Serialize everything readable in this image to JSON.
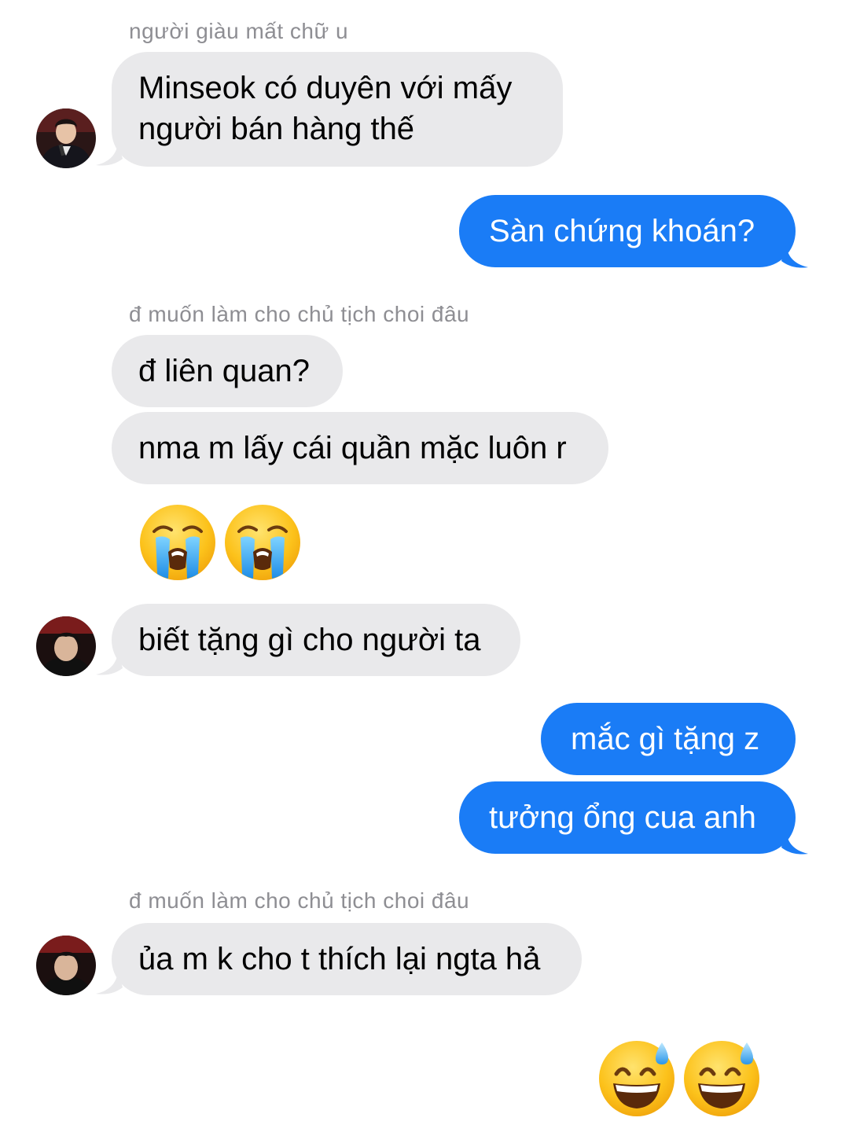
{
  "conversation": {
    "colors": {
      "incoming_bubble": "#e9e9eb",
      "outgoing_bubble": "#1a7cf6",
      "sender_name": "#8e8e93"
    },
    "messages": [
      {
        "id": "m1",
        "direction": "incoming",
        "sender": "người giàu mất chữ u",
        "lines": [
          "Minseok có duyên với mấy",
          "người bán hàng thế"
        ],
        "avatar": "avatar-person-suit"
      },
      {
        "id": "m2",
        "direction": "outgoing",
        "lines": [
          "Sàn chứng khoán?"
        ]
      },
      {
        "id": "m3",
        "direction": "incoming",
        "sender": "đ muốn làm cho chủ tịch choi đâu",
        "lines": [
          "đ liên quan?"
        ]
      },
      {
        "id": "m4",
        "direction": "incoming",
        "lines": [
          "nma m lấy cái quần mặc luôn r"
        ]
      },
      {
        "id": "m5",
        "direction": "incoming",
        "emoji": "loudly-crying-face",
        "count": 2
      },
      {
        "id": "m6",
        "direction": "incoming",
        "lines": [
          "biết tặng gì cho người ta"
        ],
        "avatar": "avatar-person-dark"
      },
      {
        "id": "m7",
        "direction": "outgoing",
        "lines": [
          "mắc gì tặng z"
        ]
      },
      {
        "id": "m8",
        "direction": "outgoing",
        "lines": [
          "tưởng ổng cua anh"
        ]
      },
      {
        "id": "m9",
        "direction": "incoming",
        "sender": "đ muốn làm cho chủ tịch choi đâu",
        "lines": [
          "ủa m k cho t thích lại ngta hả"
        ],
        "avatar": "avatar-person-dark"
      },
      {
        "id": "m10",
        "direction": "outgoing",
        "emoji": "grinning-face-with-sweat",
        "count": 2
      }
    ]
  }
}
